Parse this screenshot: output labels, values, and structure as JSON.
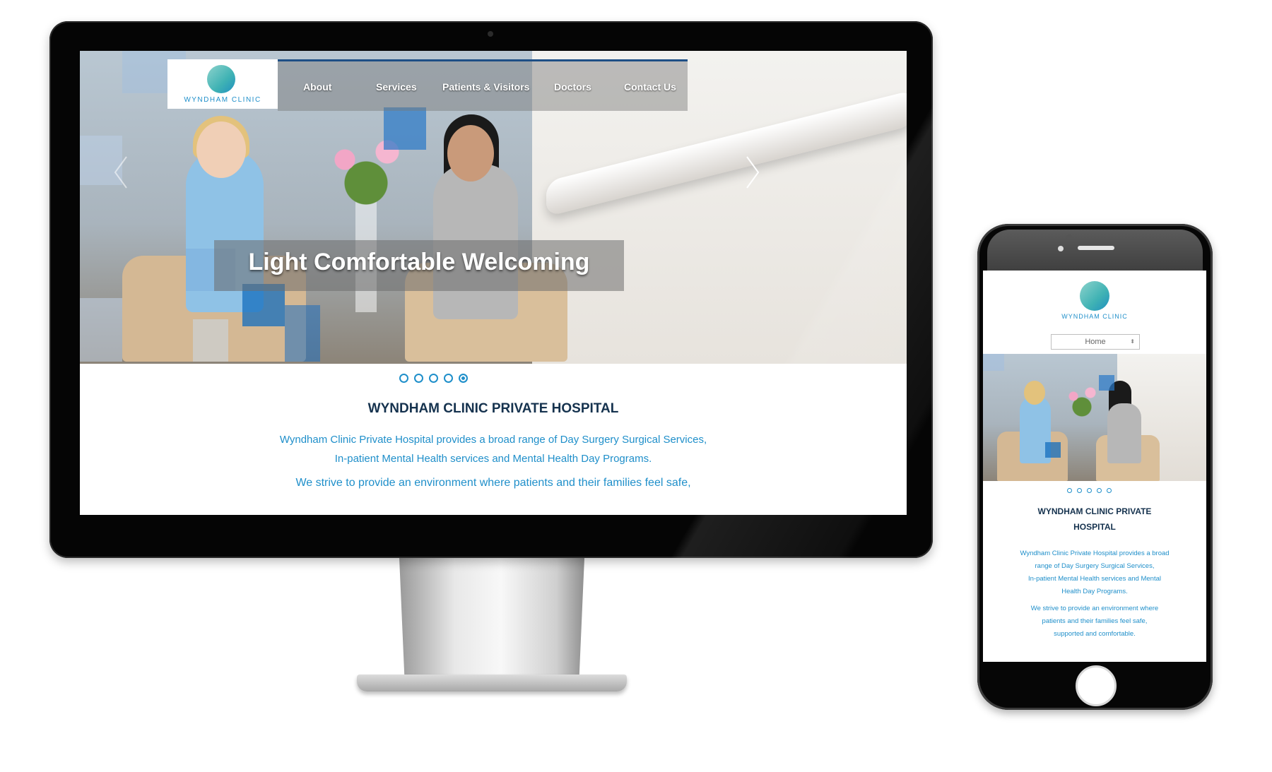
{
  "desktop": {
    "nav": {
      "logo_text": "WYNDHAM CLINIC",
      "items": [
        {
          "label": "About"
        },
        {
          "label": "Services"
        },
        {
          "label": "Patients & Visitors"
        },
        {
          "label": "Doctors"
        },
        {
          "label": "Contact Us"
        }
      ]
    },
    "hero": {
      "caption": "Light Comfortable Welcoming",
      "slide_count": 5
    },
    "content": {
      "title": "WYNDHAM CLINIC PRIVATE HOSPITAL",
      "line1": "Wyndham Clinic Private Hospital provides a broad range of Day Surgery Surgical Services,",
      "line2": "In-patient Mental Health services and Mental Health Day Programs.",
      "line3": "We strive to provide an environment where patients and their families feel safe,"
    }
  },
  "mobile": {
    "logo_text": "WYNDHAM CLINIC",
    "select_value": "Home",
    "title_line1": "WYNDHAM CLINIC PRIVATE",
    "title_line2": "HOSPITAL",
    "para1": [
      "Wyndham Clinic Private Hospital provides a broad",
      "range of Day Surgery Surgical Services,",
      "In-patient Mental Health services and Mental",
      "Health Day Programs."
    ],
    "para2": [
      "We strive to provide an environment where",
      "patients and their families feel safe,",
      "supported and comfortable."
    ]
  },
  "colors": {
    "brand_blue": "#1f8fca",
    "navy": "#15324e",
    "nav_rule": "#1e4f86"
  }
}
